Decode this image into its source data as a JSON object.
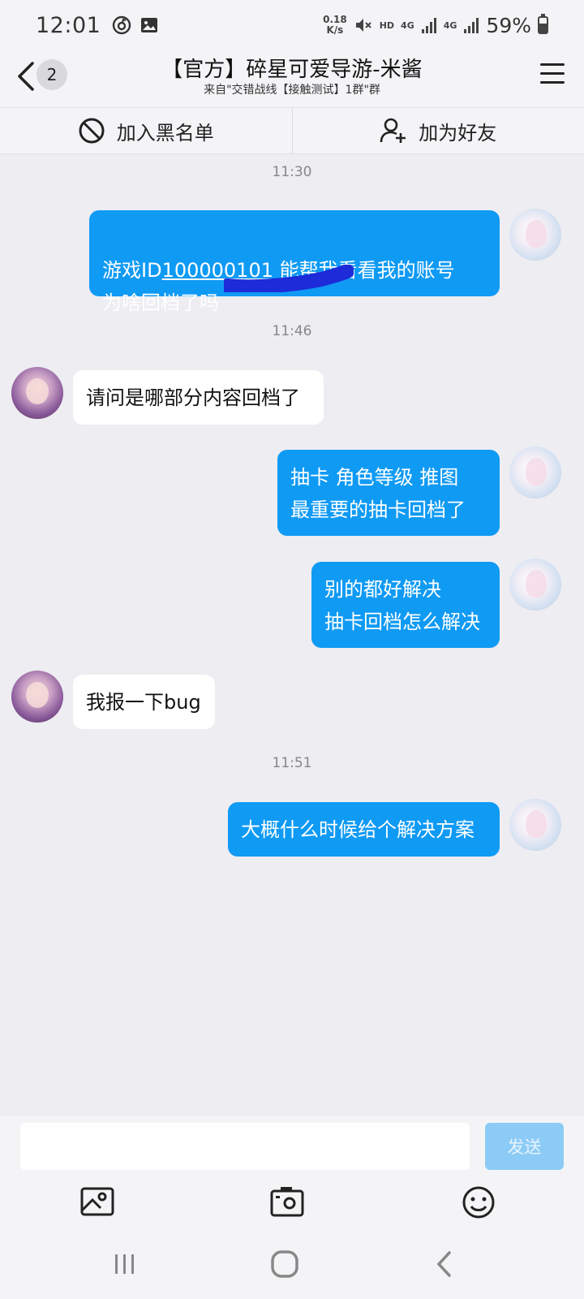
{
  "status_bar": {
    "time": "12:01",
    "net_speed_value": "0.18",
    "net_speed_unit": "K/s",
    "hd": "HD",
    "net1": "4G",
    "net2": "4G",
    "battery": "59%",
    "icons": [
      "netease-music-icon",
      "image-icon",
      "mute-icon",
      "signal-icon",
      "battery-icon"
    ]
  },
  "header": {
    "back_count": "2",
    "title": "【官方】碎星可爱导游-米酱",
    "subtitle": "来自\"交错战线【接触测试】1群\"群"
  },
  "actions": {
    "blacklist": "加入黑名单",
    "add_friend": "加为好友"
  },
  "chat": {
    "times": [
      "11:30",
      "11:46",
      "11:51"
    ],
    "messages": [
      {
        "from": "me",
        "prefix": "游戏ID",
        "redacted_id": "100000101",
        "rest": " 能帮我看看我的账号\n为啥回档了吗"
      },
      {
        "from": "them",
        "text": "请问是哪部分内容回档了"
      },
      {
        "from": "me",
        "text": "抽卡  角色等级  推图\n最重要的抽卡回档了"
      },
      {
        "from": "me",
        "text": "别的都好解决\n抽卡回档怎么解决"
      },
      {
        "from": "them",
        "text": "我报一下bug"
      },
      {
        "from": "me",
        "text": "大概什么时候给个解决方案"
      }
    ]
  },
  "input": {
    "value": "",
    "send_label": "发送"
  },
  "colors": {
    "accent": "#0f9af4",
    "send_disabled": "#8ccbf6",
    "background": "#ededf2"
  }
}
